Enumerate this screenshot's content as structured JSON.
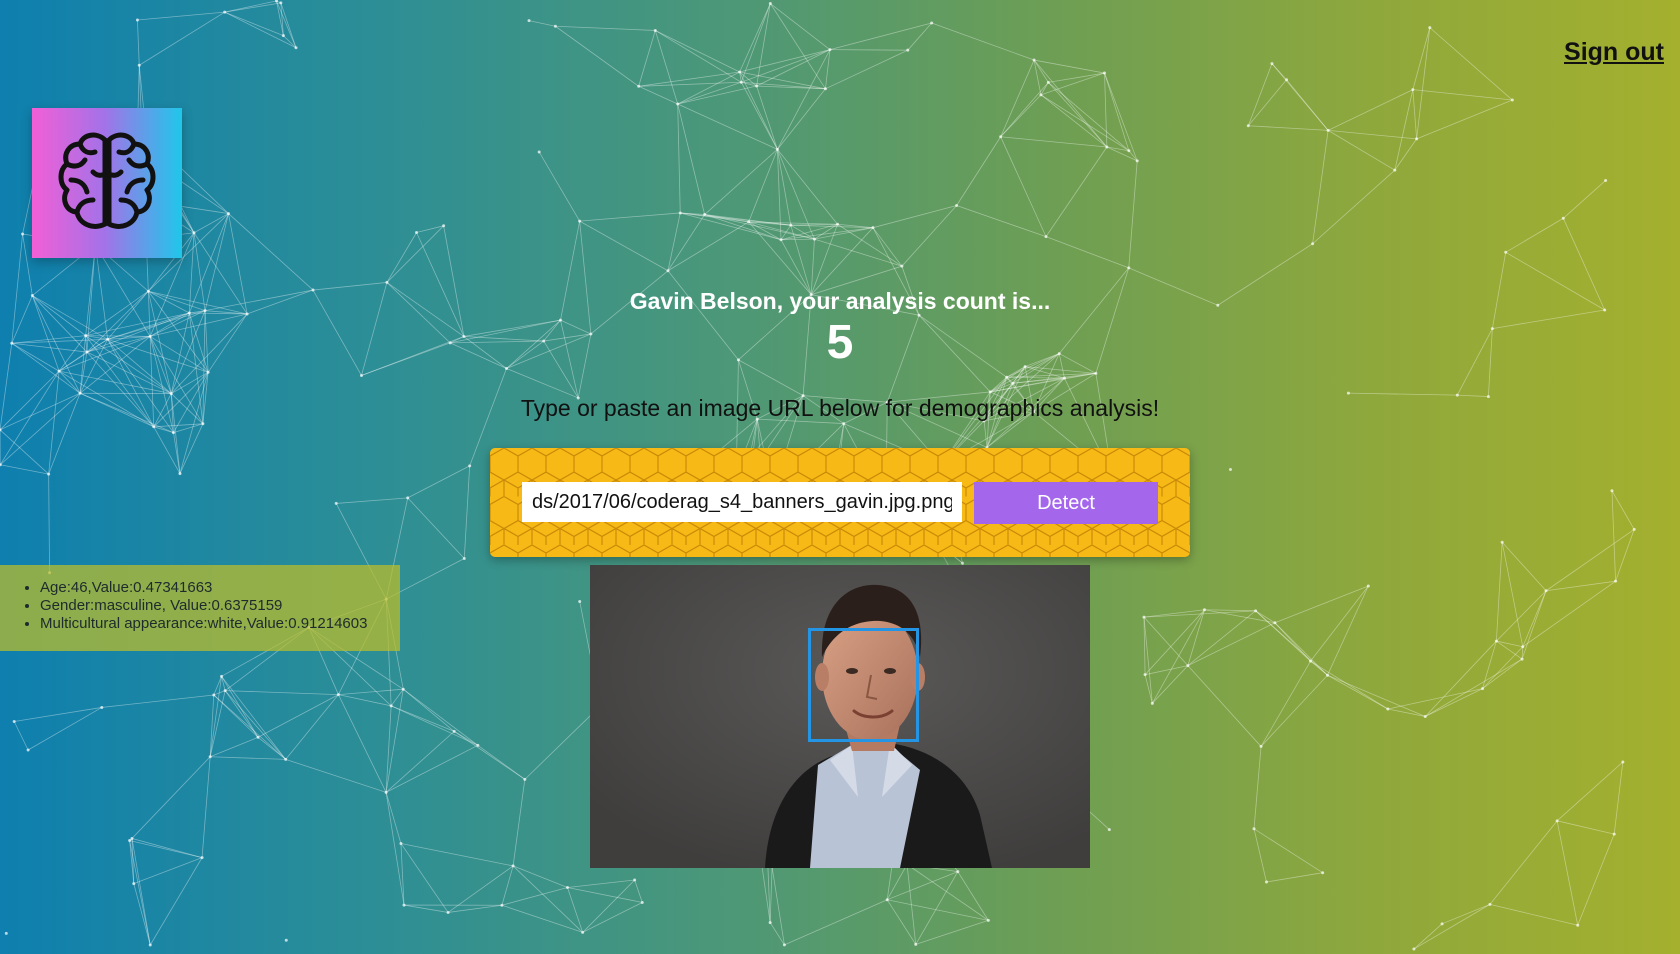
{
  "header": {
    "signout_label": "Sign out"
  },
  "logo": {
    "icon": "brain-icon",
    "gradient": [
      "#f25fd6",
      "#a472e8",
      "#1fc7ea"
    ]
  },
  "rank": {
    "welcome_text": "Gavin Belson, your analysis count is...",
    "count": "5"
  },
  "form": {
    "prompt": "Type or paste an image URL below for demographics analysis!",
    "url_value": "ds/2017/06/coderag_s4_banners_gavin.jpg.png",
    "detect_label": "Detect"
  },
  "results": [
    {
      "text": "Age:46,Value:0.47341663"
    },
    {
      "text": "Gender:masculine, Value:0.6375159"
    },
    {
      "text": "Multicultural appearance:white,Value:0.91214603"
    }
  ],
  "colors": {
    "panel": "#f7b916",
    "button": "#a467ec",
    "face_box": "#2494e4",
    "bg_left": "#0e7fae",
    "bg_right": "#a4b02e"
  }
}
